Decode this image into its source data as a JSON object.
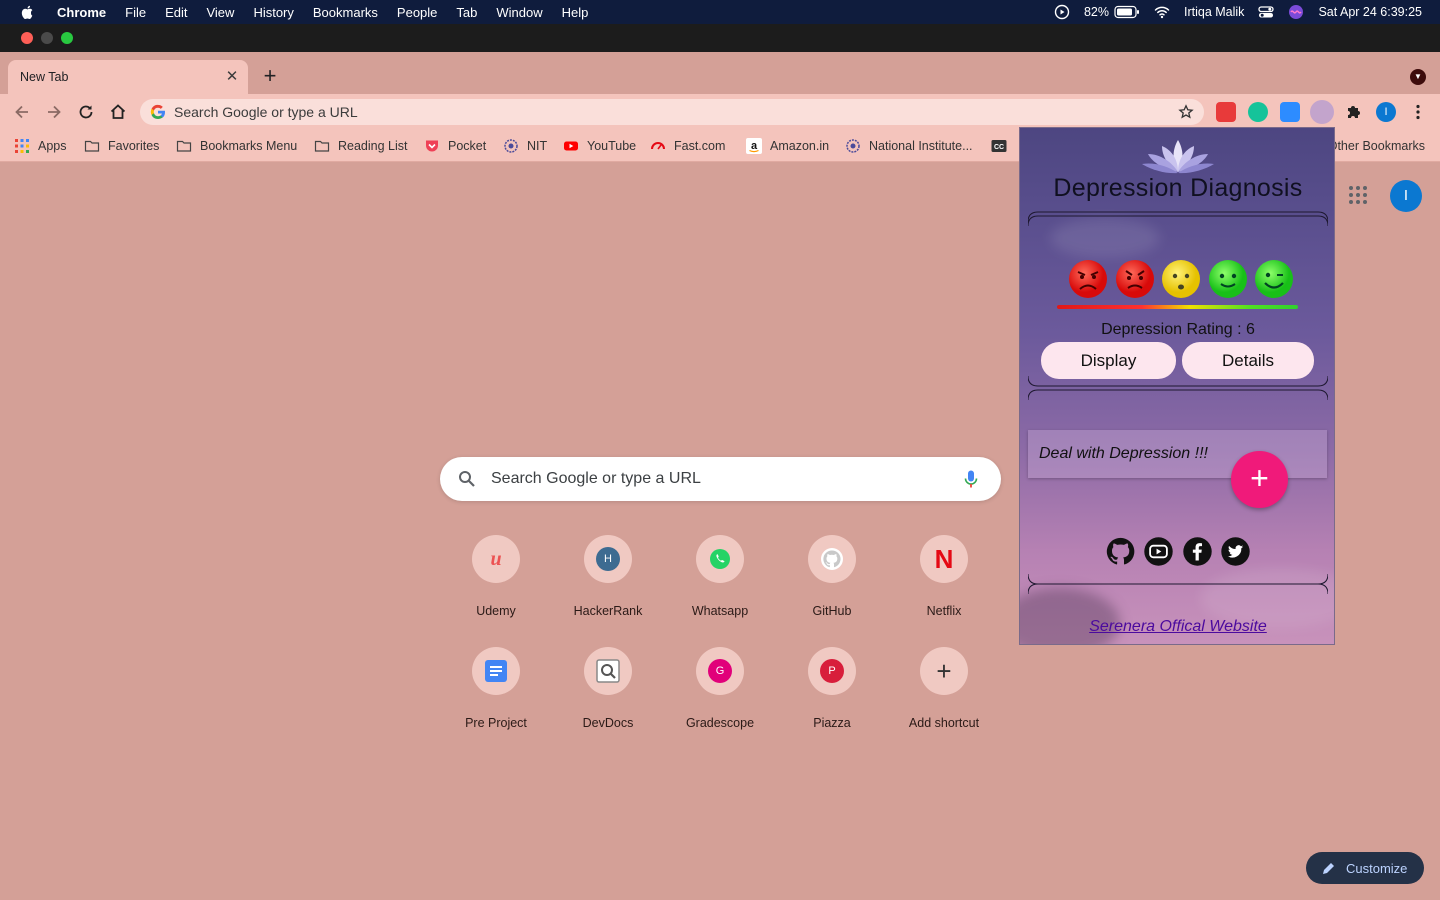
{
  "menubar": {
    "app": "Chrome",
    "items": [
      "File",
      "Edit",
      "View",
      "History",
      "Bookmarks",
      "People",
      "Tab",
      "Window",
      "Help"
    ],
    "battery": "82%",
    "user": "Irtiqa Malik",
    "datetime": "Sat Apr 24  6:39:25"
  },
  "tab": {
    "title": "New Tab",
    "close": "✕"
  },
  "omnibox": {
    "placeholder": "Search Google or type a URL"
  },
  "profile_initial": "I",
  "bookmarks": [
    "Apps",
    "Favorites",
    "Bookmarks Menu",
    "Reading List",
    "Pocket",
    "NIT",
    "YouTube",
    "Fast.com",
    "Amazon.in",
    "National Institute...",
    "Other Bookmarks"
  ],
  "ntp": {
    "search_placeholder": "Search Google or type a URL",
    "shortcuts": [
      {
        "label": "Udemy",
        "icon": "udemy-icon"
      },
      {
        "label": "HackerRank",
        "icon": "hackerrank-icon",
        "glyph": "H"
      },
      {
        "label": "Whatsapp",
        "icon": "whatsapp-icon"
      },
      {
        "label": "GitHub",
        "icon": "github-icon"
      },
      {
        "label": "Netflix",
        "icon": "netflix-icon",
        "glyph": "N"
      },
      {
        "label": "Pre Project",
        "icon": "docs-icon"
      },
      {
        "label": "DevDocs",
        "icon": "devdocs-icon"
      },
      {
        "label": "Gradescope",
        "icon": "gradescope-icon",
        "glyph": "G"
      },
      {
        "label": "Piazza",
        "icon": "piazza-icon",
        "glyph": "P"
      },
      {
        "label": "Add shortcut",
        "icon": "plus-icon",
        "glyph": "+"
      }
    ],
    "customize": "Customize"
  },
  "popup": {
    "title": "Depression Diagnosis",
    "rating_label": "Depression Rating : 6",
    "display_button": "Display",
    "details_button": "Details",
    "deal_text": "Deal with Depression !!!",
    "fab": "+",
    "website_link": "Serenera Offical Website"
  },
  "colors": {
    "page_bg": "#d4a097",
    "toolbar_bg": "#f4c4bc",
    "fab": "#f01a7a",
    "link": "#4b0a9e"
  }
}
